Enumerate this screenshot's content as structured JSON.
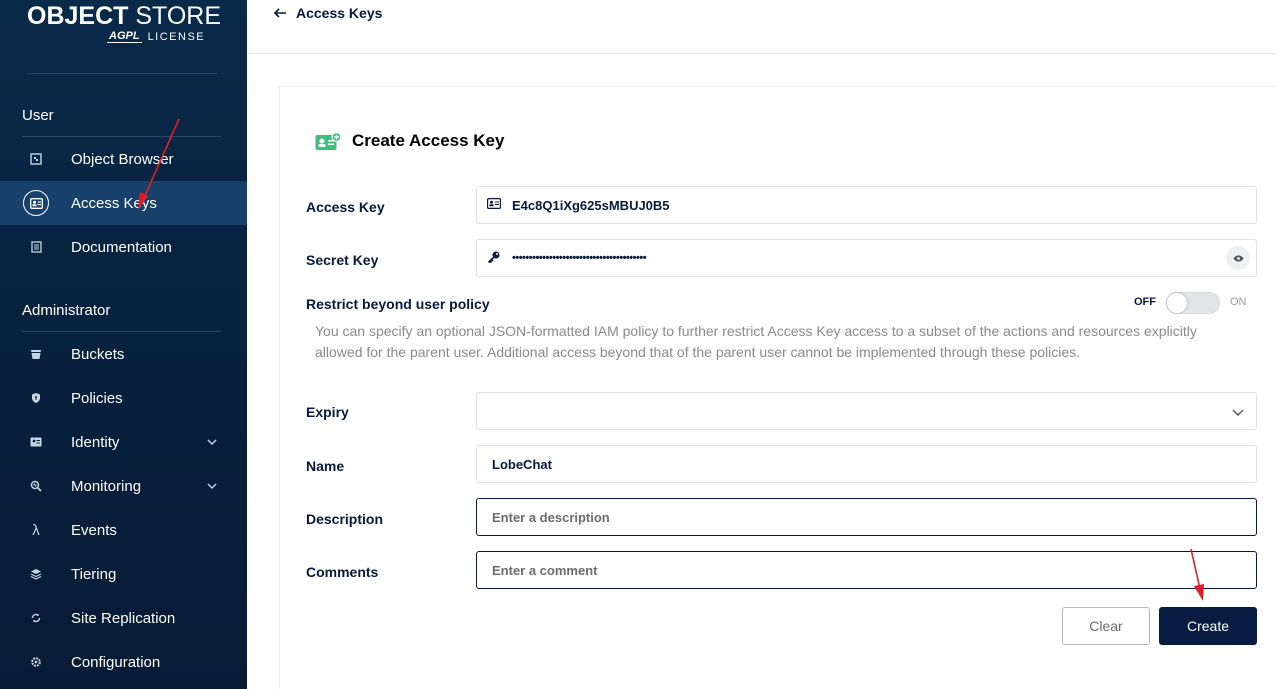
{
  "logo": {
    "brand_bold": "OBJECT",
    "brand_light": "STORE",
    "agpl": "AGPL",
    "license": "LICENSE"
  },
  "sidebar": {
    "sections": [
      {
        "title": "User",
        "items": [
          {
            "label": "Object Browser",
            "icon": "object-browser-icon"
          },
          {
            "label": "Access Keys",
            "icon": "access-keys-icon",
            "active": true
          },
          {
            "label": "Documentation",
            "icon": "documentation-icon"
          }
        ]
      },
      {
        "title": "Administrator",
        "items": [
          {
            "label": "Buckets",
            "icon": "buckets-icon"
          },
          {
            "label": "Policies",
            "icon": "policies-icon"
          },
          {
            "label": "Identity",
            "icon": "identity-icon",
            "expandable": true
          },
          {
            "label": "Monitoring",
            "icon": "monitoring-icon",
            "expandable": true
          },
          {
            "label": "Events",
            "icon": "events-icon"
          },
          {
            "label": "Tiering",
            "icon": "tiering-icon"
          },
          {
            "label": "Site Replication",
            "icon": "site-replication-icon"
          },
          {
            "label": "Configuration",
            "icon": "configuration-icon"
          }
        ]
      }
    ]
  },
  "header": {
    "back_label": "Access Keys"
  },
  "form": {
    "title": "Create Access Key",
    "access_key": {
      "label": "Access Key",
      "value": "E4c8Q1iXg625sMBUJ0B5"
    },
    "secret_key": {
      "label": "Secret Key",
      "value": "••••••••••••••••••••••••••••••••••••••••"
    },
    "restrict": {
      "label": "Restrict beyond user policy",
      "off_label": "OFF",
      "on_label": "ON",
      "enabled": false,
      "help": "You can specify an optional JSON-formatted IAM policy to further restrict Access Key access to a subset of the actions and resources explicitly allowed for the parent user. Additional access beyond that of the parent user cannot be implemented through these policies."
    },
    "expiry": {
      "label": "Expiry",
      "value": ""
    },
    "name": {
      "label": "Name",
      "value": "LobeChat"
    },
    "description": {
      "label": "Description",
      "placeholder": "Enter a description"
    },
    "comments": {
      "label": "Comments",
      "placeholder": "Enter a comment"
    },
    "buttons": {
      "clear": "Clear",
      "create": "Create"
    }
  },
  "colors": {
    "sidebar_bg": "#0a2a4a",
    "active_item": "#17406a",
    "primary": "#081c42",
    "annotation_arrow": "#e02020",
    "title_icon": "#3fbf7f"
  }
}
